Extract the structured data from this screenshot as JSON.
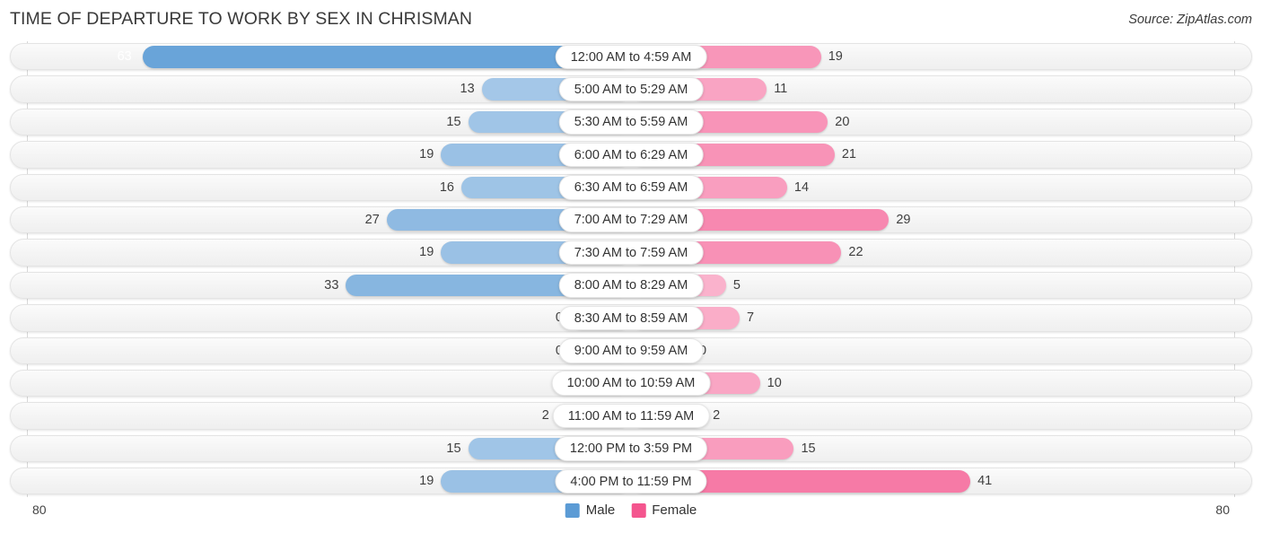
{
  "header": {
    "title": "TIME OF DEPARTURE TO WORK BY SEX IN CHRISMAN",
    "source": "Source: ZipAtlas.com"
  },
  "axis": {
    "left_tick": "80",
    "right_tick": "80"
  },
  "legend": {
    "male_label": "Male",
    "female_label": "Female",
    "male_color": "#5B9BD5",
    "female_color": "#F4558E"
  },
  "chart_data": {
    "type": "bar",
    "subtype": "diverging-horizontal",
    "title": "TIME OF DEPARTURE TO WORK BY SEX IN CHRISMAN",
    "xlabel": "",
    "ylabel": "",
    "xlim": [
      80,
      80
    ],
    "grid": false,
    "legend_position": "bottom-center",
    "categories": [
      "12:00 AM to 4:59 AM",
      "5:00 AM to 5:29 AM",
      "5:30 AM to 5:59 AM",
      "6:00 AM to 6:29 AM",
      "6:30 AM to 6:59 AM",
      "7:00 AM to 7:29 AM",
      "7:30 AM to 7:59 AM",
      "8:00 AM to 8:29 AM",
      "8:30 AM to 8:59 AM",
      "9:00 AM to 9:59 AM",
      "10:00 AM to 10:59 AM",
      "11:00 AM to 11:59 AM",
      "12:00 PM to 3:59 PM",
      "4:00 PM to 11:59 PM"
    ],
    "series": [
      {
        "name": "Male",
        "direction": "left",
        "color": "#5B9BD5",
        "values": [
          63,
          13,
          15,
          19,
          16,
          27,
          19,
          33,
          0,
          0,
          0,
          2,
          15,
          19
        ]
      },
      {
        "name": "Female",
        "direction": "right",
        "color": "#F4558E",
        "values": [
          19,
          11,
          20,
          21,
          14,
          29,
          22,
          5,
          7,
          0,
          10,
          2,
          15,
          41
        ]
      }
    ]
  },
  "rows": [
    {
      "label": "12:00 AM to 4:59 AM",
      "male": "63",
      "female": "19",
      "male_v": 63,
      "female_v": 19
    },
    {
      "label": "5:00 AM to 5:29 AM",
      "male": "13",
      "female": "11",
      "male_v": 13,
      "female_v": 11
    },
    {
      "label": "5:30 AM to 5:59 AM",
      "male": "15",
      "female": "20",
      "male_v": 15,
      "female_v": 20
    },
    {
      "label": "6:00 AM to 6:29 AM",
      "male": "19",
      "female": "21",
      "male_v": 19,
      "female_v": 21
    },
    {
      "label": "6:30 AM to 6:59 AM",
      "male": "16",
      "female": "14",
      "male_v": 16,
      "female_v": 14
    },
    {
      "label": "7:00 AM to 7:29 AM",
      "male": "27",
      "female": "29",
      "male_v": 27,
      "female_v": 29
    },
    {
      "label": "7:30 AM to 7:59 AM",
      "male": "19",
      "female": "22",
      "male_v": 19,
      "female_v": 22
    },
    {
      "label": "8:00 AM to 8:29 AM",
      "male": "33",
      "female": "5",
      "male_v": 33,
      "female_v": 5
    },
    {
      "label": "8:30 AM to 8:59 AM",
      "male": "0",
      "female": "7",
      "male_v": 0,
      "female_v": 7
    },
    {
      "label": "9:00 AM to 9:59 AM",
      "male": "0",
      "female": "0",
      "male_v": 0,
      "female_v": 0
    },
    {
      "label": "10:00 AM to 10:59 AM",
      "male": "0",
      "female": "10",
      "male_v": 0,
      "female_v": 10
    },
    {
      "label": "11:00 AM to 11:59 AM",
      "male": "2",
      "female": "2",
      "male_v": 2,
      "female_v": 2
    },
    {
      "label": "12:00 PM to 3:59 PM",
      "male": "15",
      "female": "15",
      "male_v": 15,
      "female_v": 15
    },
    {
      "label": "4:00 PM to 11:59 PM",
      "male": "19",
      "female": "41",
      "male_v": 19,
      "female_v": 41
    }
  ]
}
